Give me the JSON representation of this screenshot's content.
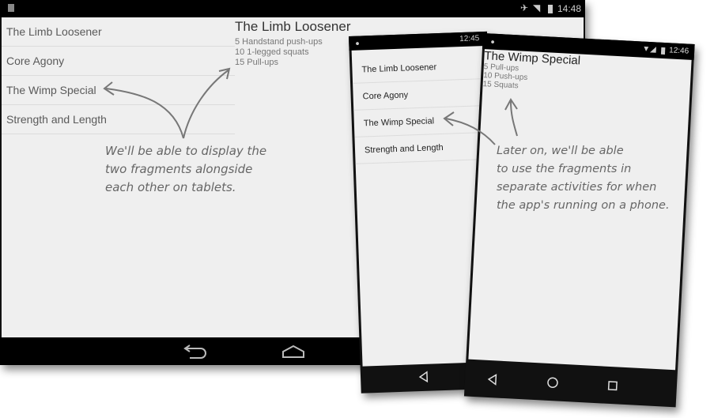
{
  "tablet": {
    "status": {
      "time": "14:48"
    },
    "list": [
      "The Limb Loosener",
      "Core Agony",
      "The Wimp Special",
      "Strength and Length"
    ],
    "detail": {
      "title": "The Limb Loosener",
      "lines": [
        "5 Handstand push-ups",
        "10 1-legged squats",
        "15 Pull-ups"
      ]
    }
  },
  "phone_list": {
    "status": {
      "time": "12:45"
    },
    "list": [
      "The Limb Loosener",
      "Core Agony",
      "The Wimp Special",
      "Strength and Length"
    ]
  },
  "phone_detail": {
    "status": {
      "time": "12:46"
    },
    "detail": {
      "title": "The Wimp Special",
      "lines": [
        "5 Pull-ups",
        "10 Push-ups",
        "15 Squats"
      ]
    }
  },
  "annotations": {
    "tablet_note": [
      "We'll be able to display the",
      "two fragments alongside",
      "each other on tablets."
    ],
    "phone_note": [
      "Later on, we'll be able",
      "to use the fragments in",
      "separate activities for when",
      "the app's running on a phone."
    ]
  }
}
